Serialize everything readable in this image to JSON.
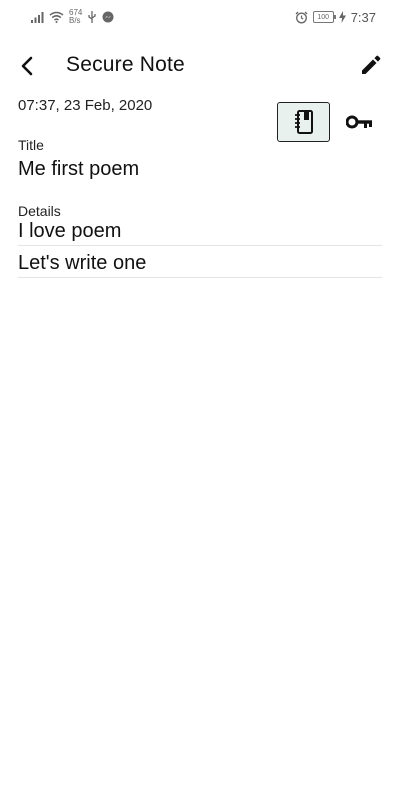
{
  "status_bar": {
    "net_speed_value": "674",
    "net_speed_unit": "B/s",
    "battery": "100",
    "time": "7:37"
  },
  "app_bar": {
    "title": "Secure Note"
  },
  "note": {
    "timestamp": "07:37, 23 Feb, 2020",
    "title_label": "Title",
    "title_value": "Me first poem",
    "details_label": "Details",
    "details_lines": [
      "I love poem",
      "Let's write one"
    ]
  },
  "icons": {
    "back": "arrow-back-icon",
    "edit": "pencil-icon",
    "note_type": "notebook-icon",
    "password": "key-icon"
  }
}
